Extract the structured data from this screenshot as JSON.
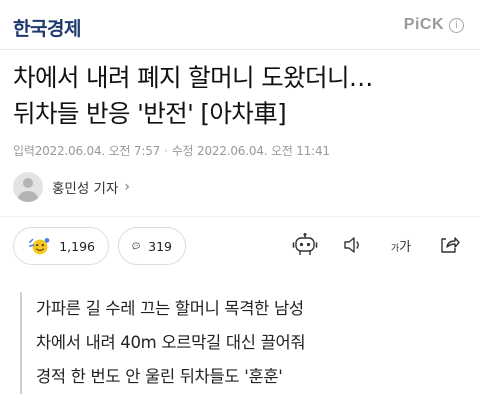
{
  "header": {
    "brand": "한국경제",
    "pick_label": "PiCK",
    "info_icon": "info-circle-icon"
  },
  "article": {
    "title_lines": [
      "차에서 내려 폐지 할머니 도왔더니…",
      "뒤차들 반응 '반전' [아차車]"
    ],
    "published_label": "입력",
    "published": "2022.06.04. 오전 7:57",
    "modified_label": "수정",
    "modified": "2022.06.04. 오전 11:41"
  },
  "reporter": {
    "name": "홍민성 기자",
    "chevron": "›"
  },
  "actions": {
    "likes": "1,196",
    "comments": "319",
    "font_label_small": "가",
    "font_label_big": "가",
    "icons": [
      "reaction-emoji-icon",
      "comment-bubble-icon",
      "robot-summary-icon",
      "audio-speaker-icon",
      "font-size-icon",
      "share-icon"
    ]
  },
  "summary": [
    "가파른 길 수레 끄는 할머니 목격한 남성",
    "차에서 내려 40m 오르막길 대신 끌어줘",
    "경적 한 번도 안 울린 뒤차들도 '훈훈'"
  ],
  "colors": {
    "brand": "#1d3a6e",
    "meta_text": "#999999",
    "emoji_yellow": "#f6c624",
    "emoji_blue": "#3b7bea"
  }
}
